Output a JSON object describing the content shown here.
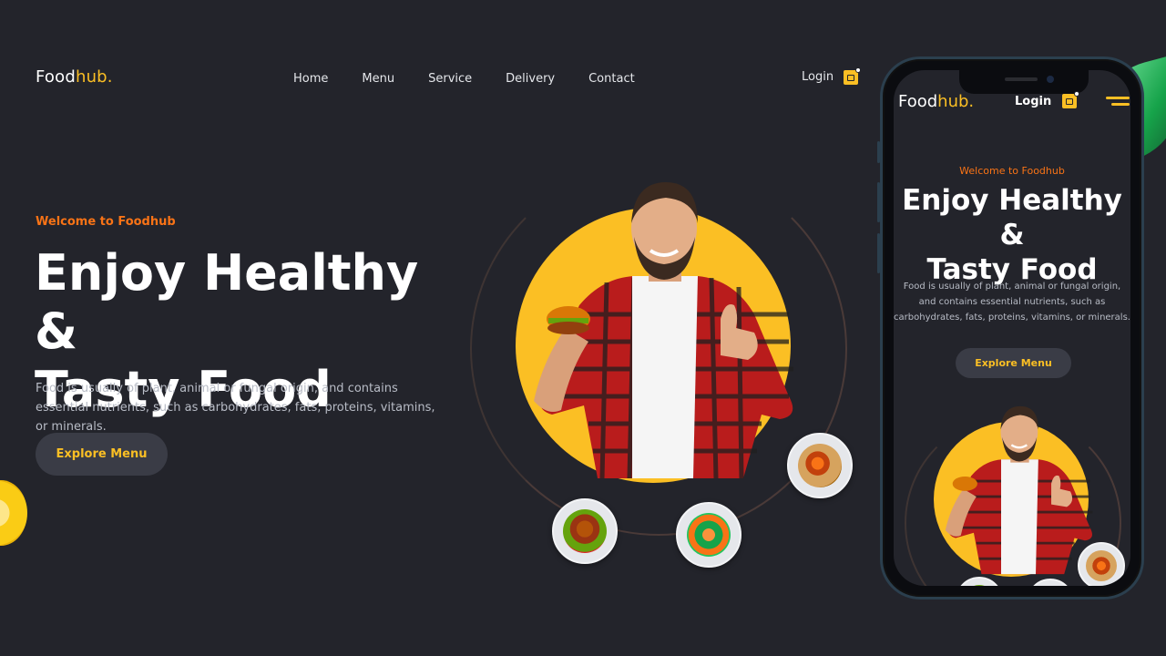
{
  "header": {
    "logo": {
      "part1": "Food",
      "part2": "hub."
    },
    "nav": [
      {
        "label": "Home"
      },
      {
        "label": "Menu"
      },
      {
        "label": "Service"
      },
      {
        "label": "Delivery"
      },
      {
        "label": "Contact"
      }
    ],
    "login_label": "Login",
    "cart_icon": "shopping-bag-icon"
  },
  "hero": {
    "welcome": "Welcome to Foodhub",
    "title_line1": "Enjoy Healthy &",
    "title_line2": "Tasty Food",
    "description": "Food is usually of plant, animal or fungal origin, and contains essential nutrients, such as carbohydrates, fats, proteins, vitamins, or minerals.",
    "cta_label": "Explore Menu"
  },
  "mobile": {
    "logo": {
      "part1": "Food",
      "part2": "hub."
    },
    "login_label": "Login",
    "menu_icon": "hamburger-menu-icon",
    "welcome": "Welcome to Foodhub",
    "title_line1": "Enjoy Healthy &",
    "title_line2": "Tasty Food",
    "description": "Food is usually of plant, animal or fungal origin, and contains essential nutrients, such as carbohydrates, fats, proteins, vitamins, or minerals.",
    "cta_label": "Explore Menu"
  },
  "colors": {
    "background": "#23242b",
    "accent": "#fbbf24",
    "welcome": "#f97316",
    "button_bg": "#3a3c46"
  }
}
